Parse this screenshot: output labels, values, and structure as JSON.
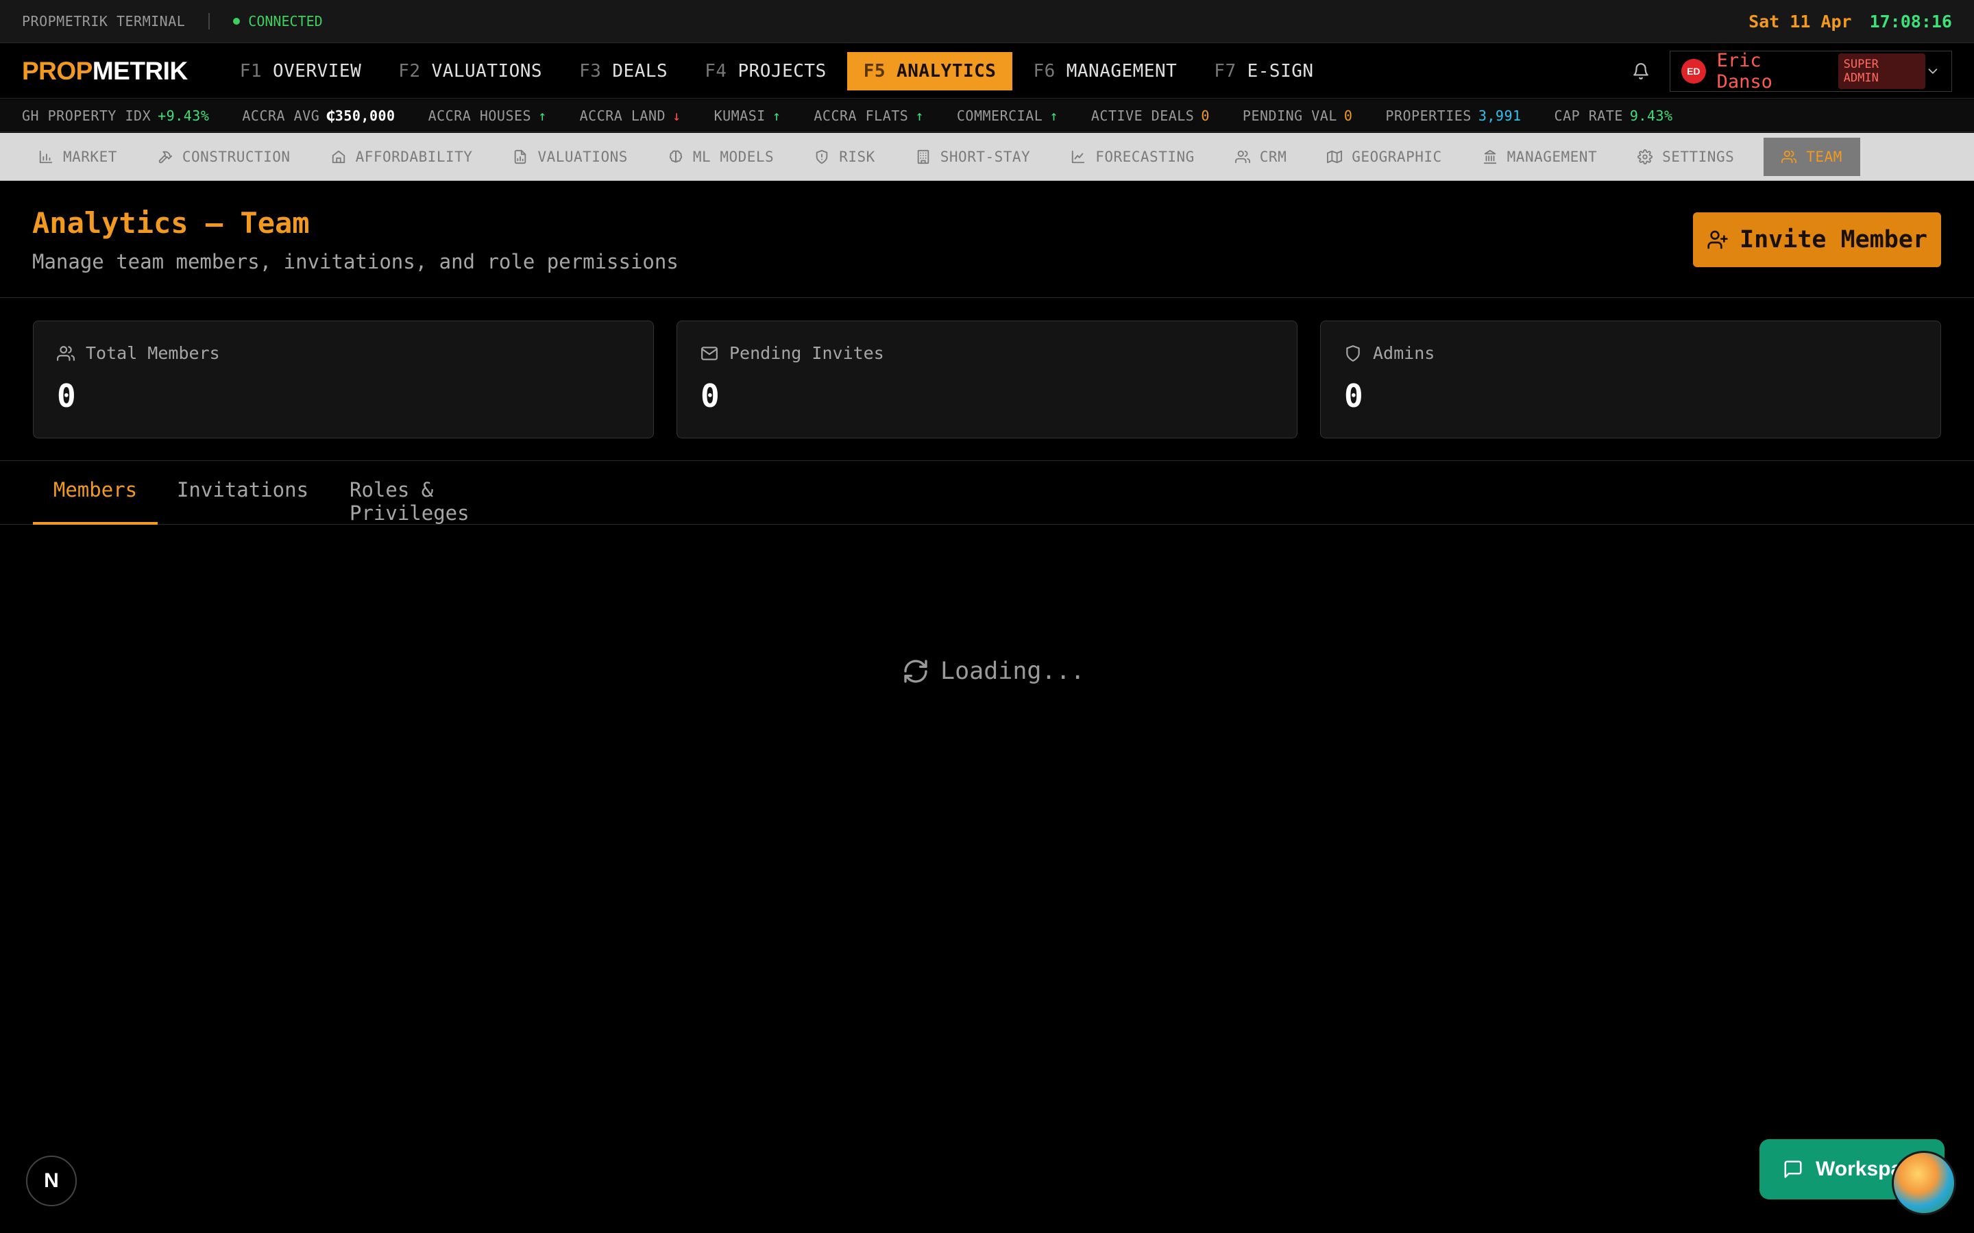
{
  "status": {
    "terminal": "PROPMETRIK TERMINAL",
    "connection": "CONNECTED",
    "date": "Sat 11 Apr",
    "time": "17:08:16"
  },
  "brand": {
    "part1": "PROP",
    "part2": "METRIK"
  },
  "nav": [
    {
      "key": "F1",
      "label": "OVERVIEW"
    },
    {
      "key": "F2",
      "label": "VALUATIONS"
    },
    {
      "key": "F3",
      "label": "DEALS"
    },
    {
      "key": "F4",
      "label": "PROJECTS"
    },
    {
      "key": "F5",
      "label": "ANALYTICS"
    },
    {
      "key": "F6",
      "label": "MANAGEMENT"
    },
    {
      "key": "F7",
      "label": "E-SIGN"
    }
  ],
  "user": {
    "initials": "ED",
    "name": "Eric Danso",
    "role": "SUPER ADMIN"
  },
  "ticker": [
    {
      "label": "GH PROPERTY IDX",
      "value": "+9.43%"
    },
    {
      "label": "ACCRA AVG",
      "value": "₵350,000"
    },
    {
      "label": "ACCRA HOUSES",
      "value": "↑"
    },
    {
      "label": "ACCRA LAND",
      "value": "↓"
    },
    {
      "label": "KUMASI",
      "value": "↑"
    },
    {
      "label": "ACCRA FLATS",
      "value": "↑"
    },
    {
      "label": "COMMERCIAL",
      "value": "↑"
    },
    {
      "label": "ACTIVE DEALS",
      "value": "0"
    },
    {
      "label": "PENDING VAL",
      "value": "0"
    },
    {
      "label": "PROPERTIES",
      "value": "3,991"
    },
    {
      "label": "CAP RATE",
      "value": "9.43%"
    }
  ],
  "subnav": [
    "MARKET",
    "CONSTRUCTION",
    "AFFORDABILITY",
    "VALUATIONS",
    "ML MODELS",
    "RISK",
    "SHORT-STAY",
    "FORECASTING",
    "CRM",
    "GEOGRAPHIC",
    "MANAGEMENT",
    "SETTINGS",
    "TEAM"
  ],
  "page": {
    "title": "Analytics — Team",
    "subtitle": "Manage team members, invitations, and role permissions",
    "invite_label": "Invite Member"
  },
  "stats": [
    {
      "label": "Total Members",
      "value": "0"
    },
    {
      "label": "Pending Invites",
      "value": "0"
    },
    {
      "label": "Admins",
      "value": "0"
    }
  ],
  "tabs": [
    "Members",
    "Invitations",
    "Roles & Privileges"
  ],
  "loading": "Loading...",
  "floating": {
    "badge": "N",
    "workspace_label": "Workspace"
  },
  "colors": {
    "accent": "#f29a1f",
    "positive": "#3ee07a",
    "negative": "#ff4b4b",
    "info": "#2ec4ef"
  }
}
